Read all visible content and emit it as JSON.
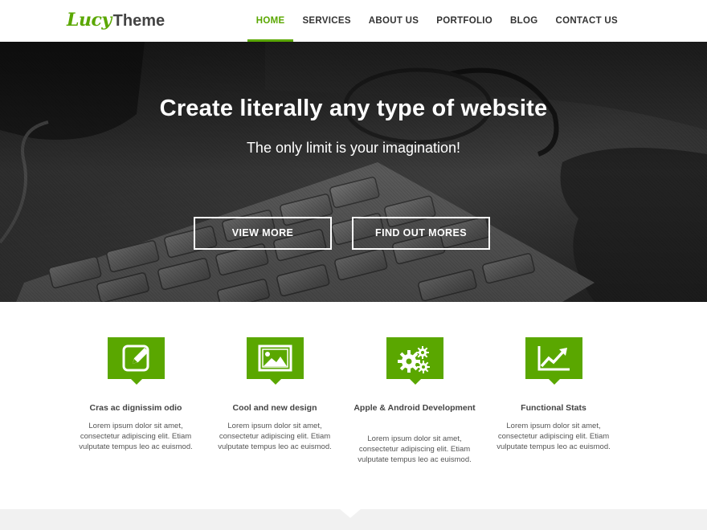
{
  "brand": {
    "script": "Lucy",
    "word": "Theme",
    "accent_color": "#5aa700"
  },
  "nav": {
    "items": [
      {
        "label": "HOME",
        "active": true
      },
      {
        "label": "SERVICES",
        "active": false
      },
      {
        "label": "ABOUT US",
        "active": false
      },
      {
        "label": "PORTFOLIO",
        "active": false
      },
      {
        "label": "BLOG",
        "active": false
      },
      {
        "label": "CONTACT US",
        "active": false
      }
    ]
  },
  "hero": {
    "title": "Create literally any type of website",
    "subtitle": "The only limit is your imagination!",
    "primary_button": "VIEW MORE",
    "secondary_button": "FIND OUT MORES"
  },
  "features": [
    {
      "icon": "pencil-square-icon",
      "title": "Cras ac dignissim odio",
      "text": "Lorem ipsum dolor sit amet, consectetur adipiscing elit. Etiam vulputate tempus leo ac euismod."
    },
    {
      "icon": "image-icon",
      "title": "Cool and new design",
      "text": "Lorem ipsum dolor sit amet, consectetur adipiscing elit. Etiam vulputate tempus leo ac euismod."
    },
    {
      "icon": "gears-icon",
      "title": "Apple & Android Development",
      "text": "Lorem ipsum dolor sit amet, consectetur adipiscing elit. Etiam vulputate tempus leo ac euismod."
    },
    {
      "icon": "chart-line-icon",
      "title": "Functional Stats",
      "text": "Lorem ipsum dolor sit amet, consectetur adipiscing elit. Etiam vulputate tempus leo ac euismod."
    }
  ]
}
